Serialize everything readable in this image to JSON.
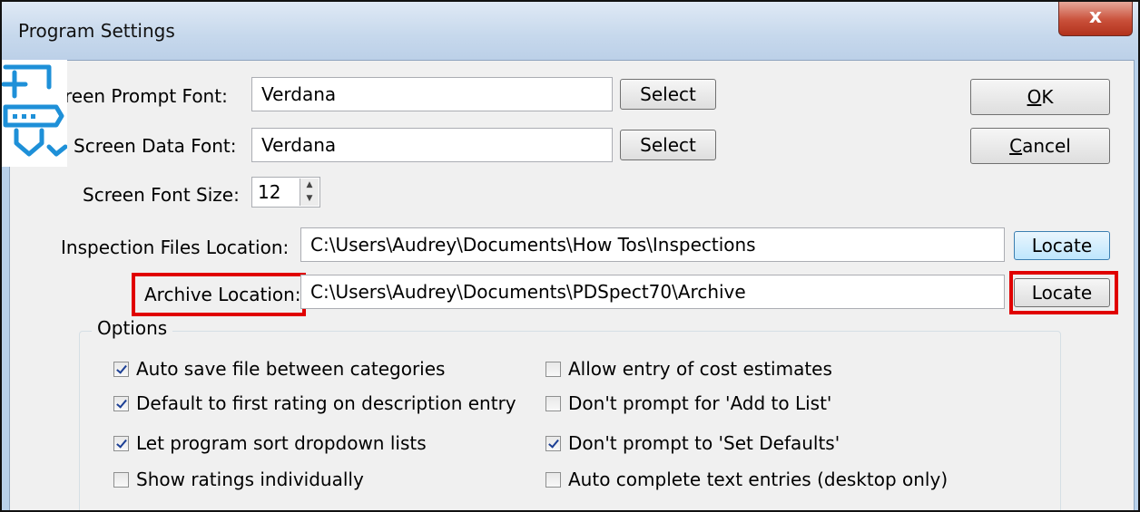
{
  "window": {
    "title": "Program Settings",
    "close_label": "x"
  },
  "fonts": {
    "prompt_label": "reen Prompt Font:",
    "prompt_value": "Verdana",
    "prompt_select": "Select",
    "data_label": "Screen Data Font:",
    "data_value": "Verdana",
    "data_select": "Select",
    "size_label": "Screen Font Size:",
    "size_value": "12"
  },
  "locations": {
    "inspection_label": "Inspection Files Location:",
    "inspection_value": "C:\\Users\\Audrey\\Documents\\How Tos\\Inspections",
    "inspection_button": "Locate",
    "archive_label": "Archive Location:",
    "archive_value": "C:\\Users\\Audrey\\Documents\\PDSpect70\\Archive",
    "archive_button": "Locate"
  },
  "buttons": {
    "ok_mnemonic": "O",
    "ok_rest": "K",
    "cancel_mnemonic": "C",
    "cancel_rest": "ancel"
  },
  "options": {
    "label": "Options",
    "items": [
      {
        "label": "Auto save file between categories",
        "checked": true
      },
      {
        "label": "Default to first rating on description entry",
        "checked": true
      },
      {
        "label": "Let program sort dropdown lists",
        "checked": true
      },
      {
        "label": "Show ratings individually",
        "checked": false
      },
      {
        "label": "Allow entry of cost estimates",
        "checked": false
      },
      {
        "label": "Don't prompt for 'Add to List'",
        "checked": false
      },
      {
        "label": "Don't prompt to 'Set Defaults'",
        "checked": true
      },
      {
        "label": "Auto complete text entries (desktop only)",
        "checked": false
      }
    ]
  },
  "colors": {
    "highlight": "#e00000",
    "accent_icon": "#1e90d8"
  },
  "icons": [
    "app-icon",
    "close-icon",
    "spin-up-icon",
    "spin-down-icon",
    "checkbox-icon"
  ]
}
